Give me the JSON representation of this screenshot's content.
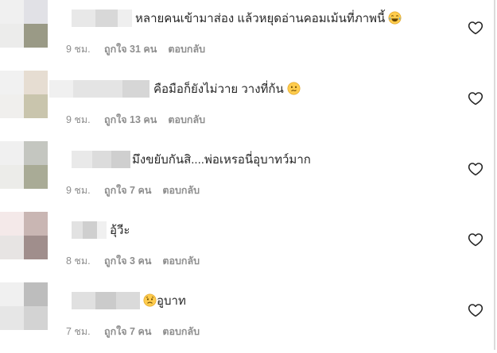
{
  "comments": [
    {
      "text": "หลายคนเข้ามาส่อง แล้วหยุดอ่านคอมเม้นที่ภาพนี้",
      "emoji": "laughing-tears",
      "emoji_position": "after",
      "time": "9 ชม.",
      "likes": "ถูกใจ 31 คน",
      "reply": "ตอบกลับ",
      "avatar_colors": [
        "#f0f0f0",
        "#e1e1e6",
        "#ececeb",
        "#9a9a86"
      ],
      "name_colors": [
        "#e8e8e8",
        "#d8d8d8",
        "#efefef"
      ]
    },
    {
      "text": "คือมือก็ยังไม่วาย วางที่ก้น",
      "emoji": "confused",
      "emoji_position": "after",
      "time": "9 ชม.",
      "likes": "ถูกใจ 13 คน",
      "reply": "ตอบกลับ",
      "avatar_colors": [
        "#f1f1f1",
        "#e6ddd2",
        "#f0efed",
        "#c9c5ad"
      ],
      "name_colors": [
        "#f0f0f0",
        "#e4e4e4",
        "#d6d6d6"
      ]
    },
    {
      "text": "มึงขยับกันสิ....พ่อเหรอนี่อุบาทว์มาก",
      "emoji": "",
      "emoji_position": "",
      "time": "9 ชม.",
      "likes": "ถูกใจ 7 คน",
      "reply": "ตอบกลับ",
      "avatar_colors": [
        "#f0f0f0",
        "#c4c6c0",
        "#ecece9",
        "#a9ab96"
      ],
      "name_colors": [
        "#e9e9e9",
        "#dcdcdc",
        "#cfcfcf"
      ]
    },
    {
      "text": "อุ้วีะ",
      "emoji": "",
      "emoji_position": "",
      "time": "8 ชม.",
      "likes": "ถูกใจ 3 คน",
      "reply": "ตอบกลับ",
      "avatar_colors": [
        "#f4e9e9",
        "#c9b6b3",
        "#e7e4e3",
        "#a08e8c"
      ],
      "name_colors": [
        "#e2e2e2",
        "#cfcfcf",
        "#f0f0f0"
      ]
    },
    {
      "text": "อูบาท",
      "emoji": "sad",
      "emoji_position": "before",
      "time": "7 ชม.",
      "likes": "ถูกใจ 7 คน",
      "reply": "ตอบกลับ",
      "avatar_colors": [
        "#f0f0f0",
        "#bdbdbd",
        "#e6e6e6",
        "#d3d3d3"
      ],
      "name_colors": [
        "#e0e0e0",
        "#cbcbcb",
        "#dadada"
      ]
    }
  ]
}
